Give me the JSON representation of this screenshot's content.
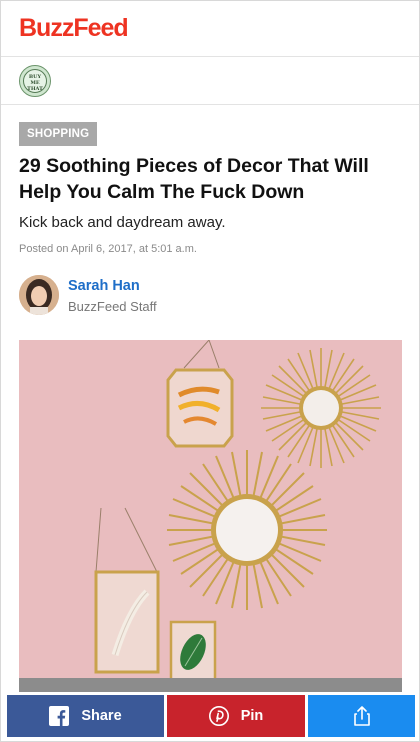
{
  "header": {
    "logo_text": "BuzzFeed",
    "logo_color": "#ee3322"
  },
  "badge": {
    "text": "BUY ME THAT"
  },
  "article": {
    "category": "SHOPPING",
    "title": "29 Soothing Pieces of Decor That Will Help You Calm The Fuck Down",
    "dek": "Kick back and daydream away.",
    "posted": "Posted on April 6, 2017, at 5:01 a.m."
  },
  "author": {
    "name": "Sarah Han",
    "role": "BuzzFeed Staff",
    "name_color": "#1e6ec8"
  },
  "hero": {
    "description": "gold-sunburst-mirrors-and-framed-botanicals-on-pink-wall"
  },
  "share": {
    "facebook_label": "Share",
    "pinterest_label": "Pin",
    "facebook_color": "#3b5998",
    "pinterest_color": "#c8232c",
    "share_color": "#1a8cf0",
    "icons": [
      "facebook-icon",
      "pinterest-icon",
      "share-icon"
    ]
  }
}
